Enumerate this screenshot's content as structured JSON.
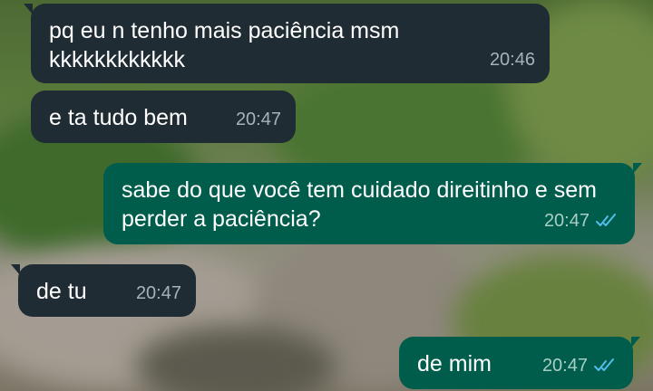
{
  "chat": {
    "messages": [
      {
        "direction": "incoming",
        "text": "pq eu n tenho mais paciência msm kkkkkkkkkkkk",
        "time": "20:46"
      },
      {
        "direction": "incoming",
        "text": "e ta tudo bem",
        "time": "20:47"
      },
      {
        "direction": "outgoing",
        "text": "sabe do que você tem cuidado direitinho e sem perder a paciência?",
        "time": "20:47",
        "status": "read"
      },
      {
        "direction": "incoming",
        "text": "de tu",
        "time": "20:47"
      },
      {
        "direction": "outgoing",
        "text": "de mim",
        "time": "20:47",
        "status": "read"
      }
    ]
  },
  "colors": {
    "incoming_bubble": "#1f2c33",
    "outgoing_bubble": "#005c4b",
    "read_tick": "#53bdeb"
  },
  "icons": {
    "read_receipt": "double-check-icon"
  }
}
